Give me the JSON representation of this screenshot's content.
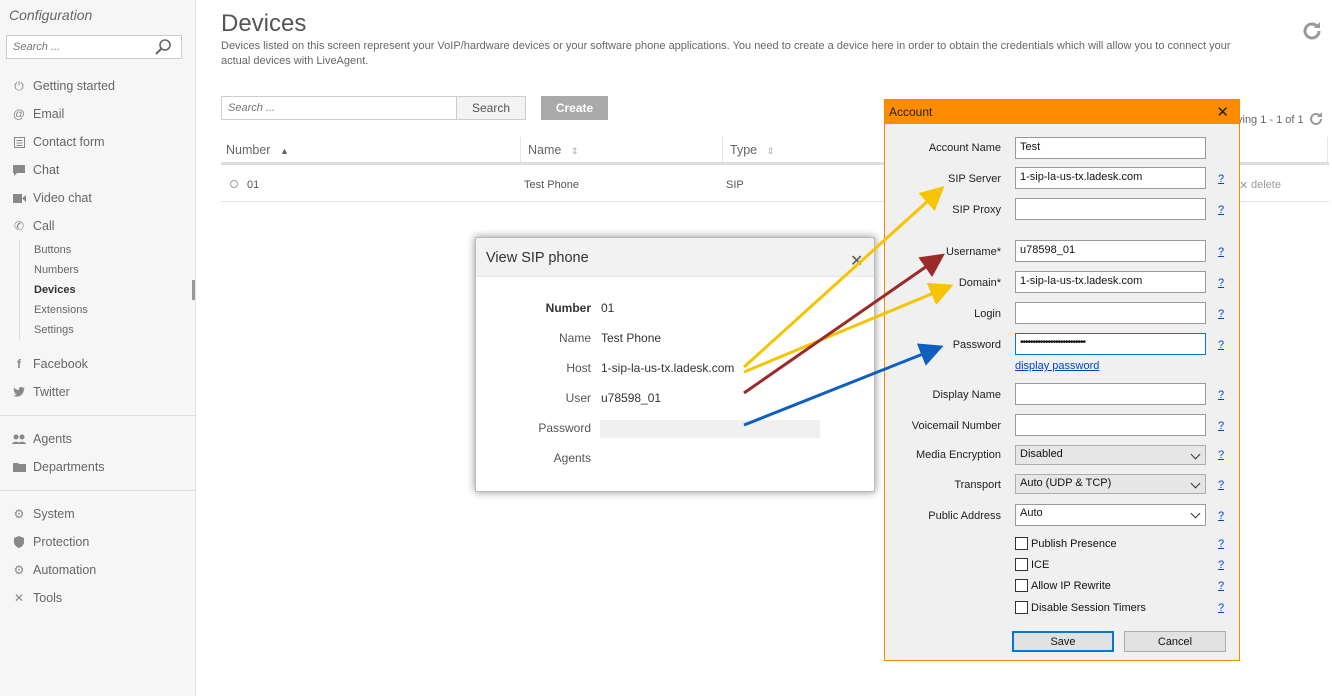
{
  "sidebar": {
    "title": "Configuration",
    "search_placeholder": "Search ...",
    "items": [
      {
        "label": "Getting started"
      },
      {
        "label": "Email"
      },
      {
        "label": "Contact form"
      },
      {
        "label": "Chat"
      },
      {
        "label": "Video chat"
      },
      {
        "label": "Call"
      }
    ],
    "call_sub": [
      {
        "label": "Buttons"
      },
      {
        "label": "Numbers"
      },
      {
        "label": "Devices"
      },
      {
        "label": "Extensions"
      },
      {
        "label": "Settings"
      }
    ],
    "social": [
      {
        "label": "Facebook"
      },
      {
        "label": "Twitter"
      }
    ],
    "team": [
      {
        "label": "Agents"
      },
      {
        "label": "Departments"
      }
    ],
    "system": [
      {
        "label": "System"
      },
      {
        "label": "Protection"
      },
      {
        "label": "Automation"
      },
      {
        "label": "Tools"
      }
    ]
  },
  "main": {
    "title": "Devices",
    "description": "Devices listed on this screen represent your VoIP/hardware devices or your software phone applications. You need to create a device here in order to obtain the credentials which will allow you to connect your actual devices with LiveAgent.",
    "search_placeholder": "Search ...",
    "search_label": "Search",
    "create_label": "Create",
    "paging": "ying 1 - 1 of 1",
    "columns": {
      "number": "Number",
      "name": "Name",
      "type": "Type"
    },
    "row": {
      "number": "01",
      "name": "Test Phone",
      "type": "SIP",
      "delete": "delete"
    }
  },
  "sip_dialog": {
    "title": "View SIP phone",
    "close": "✕",
    "number_label": "Number",
    "number": "01",
    "name_label": "Name",
    "name": "Test Phone",
    "host_label": "Host",
    "host": "1-sip-la-us-tx.ladesk.com",
    "user_label": "User",
    "user": "u78598_01",
    "password_label": "Password",
    "agents_label": "Agents"
  },
  "account": {
    "title": "Account",
    "close": "✕",
    "account_name_label": "Account Name",
    "account_name": "Test",
    "sip_server_label": "SIP Server",
    "sip_server": "1-sip-la-us-tx.ladesk.com",
    "sip_proxy_label": "SIP Proxy",
    "sip_proxy": "",
    "username_label": "Username",
    "username": "u78598_01",
    "domain_label": "Domain",
    "domain": "1-sip-la-us-tx.ladesk.com",
    "login_label": "Login",
    "login": "",
    "password_label": "Password",
    "password": "••••••••••••••••••••••••••",
    "display_password": "display password",
    "display_name_label": "Display Name",
    "voicemail_label": "Voicemail Number",
    "media_enc_label": "Media Encryption",
    "media_enc": "Disabled",
    "transport_label": "Transport",
    "transport": "Auto (UDP & TCP)",
    "public_addr_label": "Public Address",
    "public_addr": "Auto",
    "publish_presence": "Publish Presence",
    "ice": "ICE",
    "allow_ip_rewrite": "Allow IP Rewrite",
    "disable_session_timers": "Disable Session Timers",
    "help": "?",
    "required_star": "*",
    "save": "Save",
    "cancel": "Cancel"
  },
  "colors": {
    "arrow_yellow": "#f6c400",
    "arrow_darkred": "#9b2a28",
    "arrow_blue": "#0d5fc0",
    "titlebar_orange": "#ff8c00"
  }
}
